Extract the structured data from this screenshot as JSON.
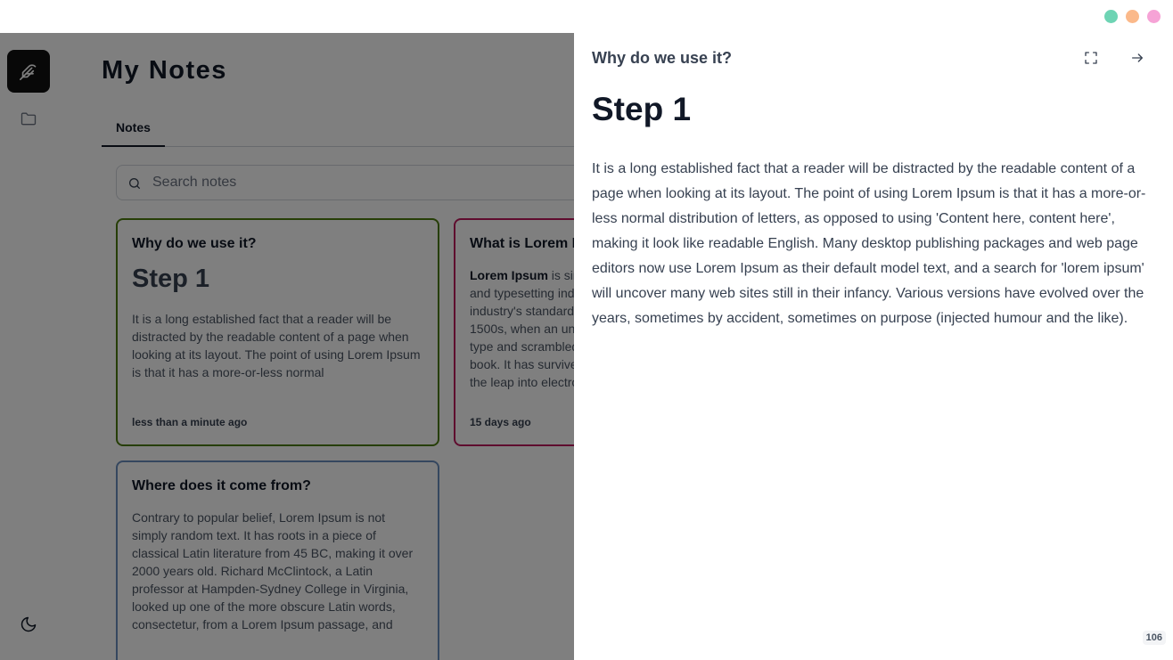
{
  "window": {
    "dot_colors": [
      "#6ed4b4",
      "#fbb98a",
      "#f6a3d6"
    ]
  },
  "sidebar": {
    "logo_icon": "feather-icon",
    "folder_icon": "folder-icon",
    "theme_icon": "moon-icon"
  },
  "main": {
    "title": "My Notes",
    "tabs": [
      {
        "label": "Notes"
      }
    ],
    "search": {
      "placeholder": "Search notes",
      "value": ""
    },
    "cards": [
      {
        "title": "Why do we use it?",
        "heading": "Step 1",
        "body": "It is a long established fact that a reader will be distracted by the readable content of a page when looking at its layout. The point of using Lorem Ipsum is that it has a more-or-less normal",
        "time": "less than a minute ago",
        "border_color": "#4d7c0f"
      },
      {
        "title": "What is Lorem Ipsum?",
        "body_bold": "Lorem Ipsum",
        "body": " is simply dummy text of the printing and typesetting industry. Lorem Ipsum has been the industry's standard dummy text ever since the 1500s, when an unknown printer took a galley of type and scrambled it to make a type specimen book. It has survived not only five centuries, but also the leap into electronic typesetting",
        "time": "15 days ago",
        "border_color": "#be185d"
      },
      {
        "title": "Where does it come from?",
        "body": "Contrary to popular belief, Lorem Ipsum is not simply random text. It has roots in a piece of classical Latin literature from 45 BC, making it over 2000 years old. Richard McClintock, a Latin professor at Hampden-Sydney College in Virginia, looked up one of the more obscure Latin words, consectetur, from a Lorem Ipsum passage, and",
        "border_color": "#6b8fbf"
      }
    ]
  },
  "panel": {
    "title": "Why do we use it?",
    "heading": "Step 1",
    "body": "It is a long established fact that a reader will be distracted by the readable content of a page when looking at its layout. The point of using Lorem Ipsum is that it has a more-or-less normal distribution of letters, as opposed to using 'Content here, content here', making it look like readable English. Many desktop publishing packages and web page editors now use Lorem Ipsum as their default model text, and a search for 'lorem ipsum' will uncover many web sites still in their infancy. Various versions have evolved over the years, sometimes by accident, sometimes on purpose (injected humour and the like).",
    "char_count": "106",
    "expand_icon": "expand-icon",
    "close_icon": "arrow-right-icon"
  }
}
